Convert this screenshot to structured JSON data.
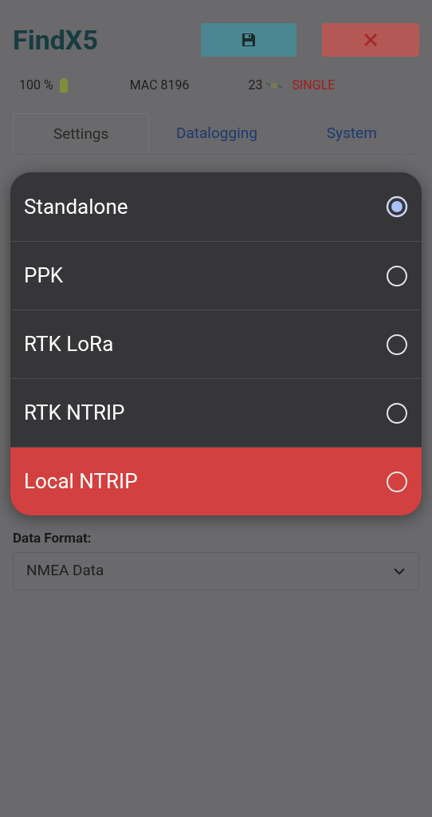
{
  "app_title": "FindX5",
  "status": {
    "battery": "100 %",
    "mac": "MAC 8196",
    "satellites": "23",
    "fix": "SINGLE"
  },
  "tabs": [
    {
      "label": "Settings",
      "selected": true
    },
    {
      "label": "Datalogging",
      "selected": false
    },
    {
      "label": "System",
      "selected": false
    }
  ],
  "mode_menu": [
    {
      "label": "Standalone",
      "selected": true,
      "highlighted": false
    },
    {
      "label": "PPK",
      "selected": false,
      "highlighted": false
    },
    {
      "label": "RTK LoRa",
      "selected": false,
      "highlighted": false
    },
    {
      "label": "RTK NTRIP",
      "selected": false,
      "highlighted": false
    },
    {
      "label": "Local NTRIP",
      "selected": false,
      "highlighted": true
    }
  ],
  "data_format": {
    "label": "Data Format:",
    "value": "NMEA Data"
  }
}
